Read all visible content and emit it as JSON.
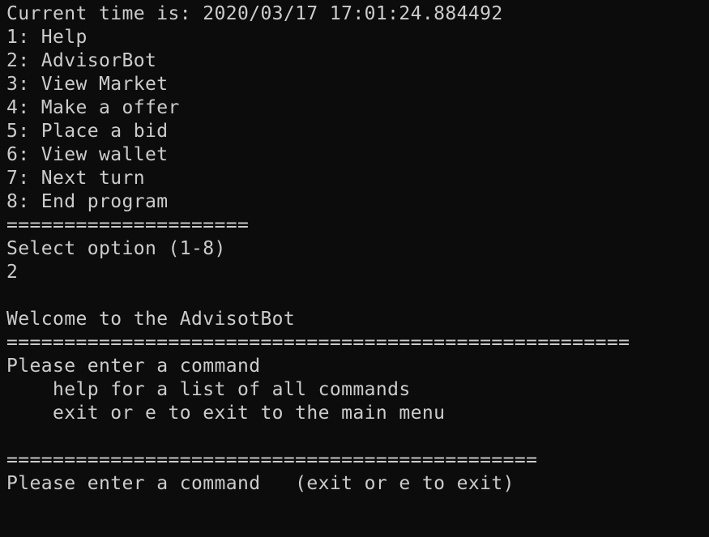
{
  "terminal": {
    "background_color": "#0c0c0c",
    "text_color": "#cccccc",
    "lines": [
      "Current time is: 2020/03/17 17:01:24.884492",
      "1: Help",
      "2: AdvisorBot",
      "3: View Market",
      "4: Make a offer",
      "5: Place a bid",
      "6: View wallet",
      "7: Next turn",
      "8: End program",
      "=====================",
      "Select option (1-8)",
      "2",
      "",
      "Welcome to the AdvisotBot",
      "======================================================",
      "Please enter a command",
      "    help for a list of all commands",
      "    exit or e to exit to the main menu",
      "",
      "==============================================",
      "Please enter a command   (exit or e to exit)"
    ]
  }
}
